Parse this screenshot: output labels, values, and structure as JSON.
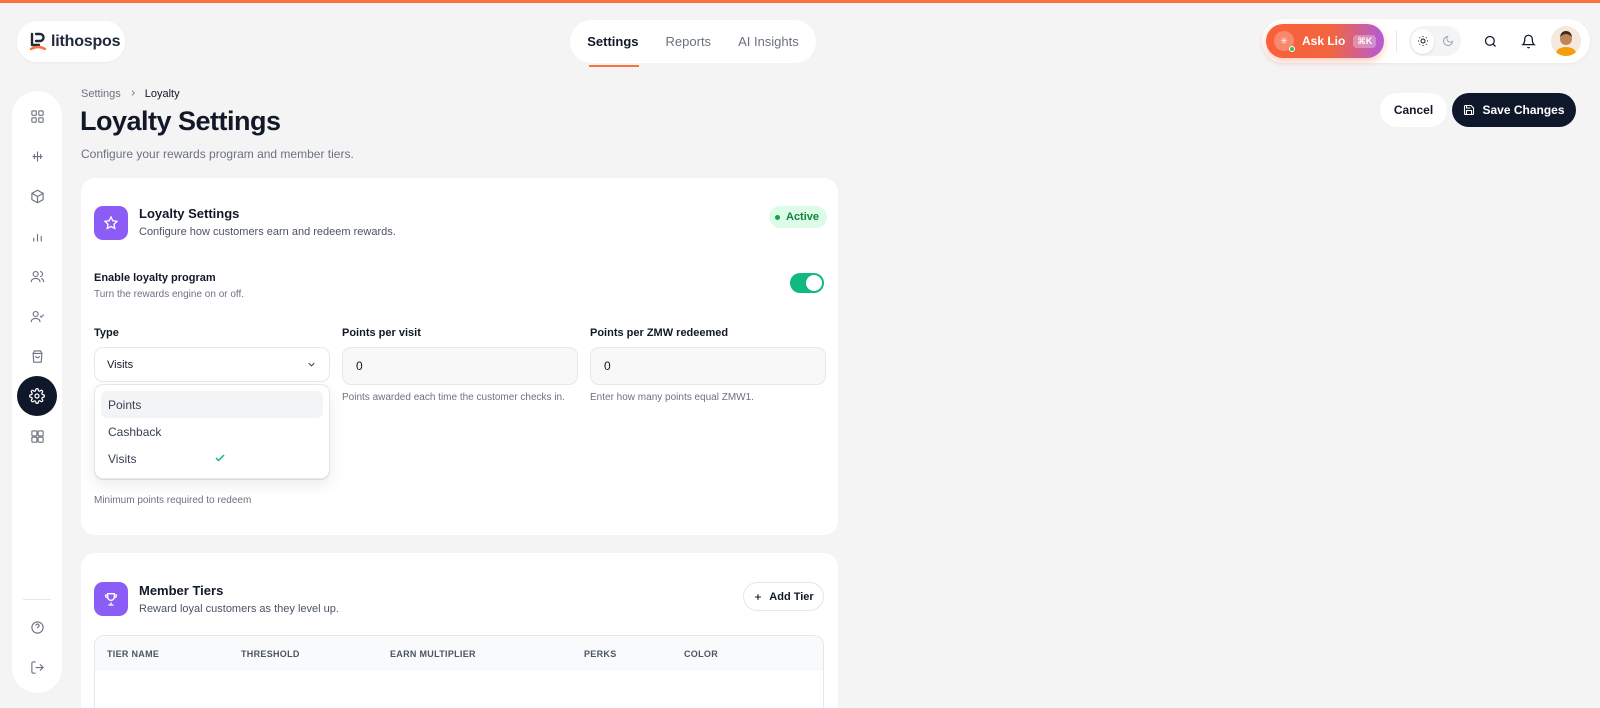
{
  "brand": {
    "name": "lithospos"
  },
  "topnav": {
    "tabs": [
      "Settings",
      "Reports",
      "AI Insights"
    ]
  },
  "topright": {
    "ask_label": "Ask Lio",
    "ask_shortcut": "⌘K"
  },
  "breadcrumb": {
    "parent": "Settings",
    "current": "Loyalty"
  },
  "page": {
    "title": "Loyalty Settings",
    "subtitle": "Configure your rewards program and member tiers."
  },
  "actions": {
    "cancel": "Cancel",
    "save": "Save Changes"
  },
  "loyalty_card": {
    "title": "Loyalty Settings",
    "subtitle": "Configure how customers earn and redeem rewards.",
    "status": "Active",
    "enable_label": "Enable loyalty program",
    "enable_help": "Turn the rewards engine on or off.",
    "enabled": true,
    "type_label": "Type",
    "type_value": "Visits",
    "type_options": [
      "Points",
      "Cashback",
      "Visits"
    ],
    "ppv_label": "Points per visit",
    "ppv_value": "0",
    "ppv_help": "Points awarded each time the customer checks in.",
    "ppz_label": "Points per ZMW redeemed",
    "ppz_value": "0",
    "ppz_help": "Enter how many points equal ZMW1.",
    "min_help": "Minimum points required to redeem"
  },
  "tiers_card": {
    "title": "Member Tiers",
    "subtitle": "Reward loyal customers as they level up.",
    "add_label": "Add Tier",
    "columns": [
      "TIER NAME",
      "THRESHOLD",
      "EARN MULTIPLIER",
      "PERKS",
      "COLOR"
    ]
  },
  "colors": {
    "accent": "#f97341",
    "primary_dark": "#0f172a",
    "purple": "#8b5cf6",
    "green": "#10b981"
  }
}
